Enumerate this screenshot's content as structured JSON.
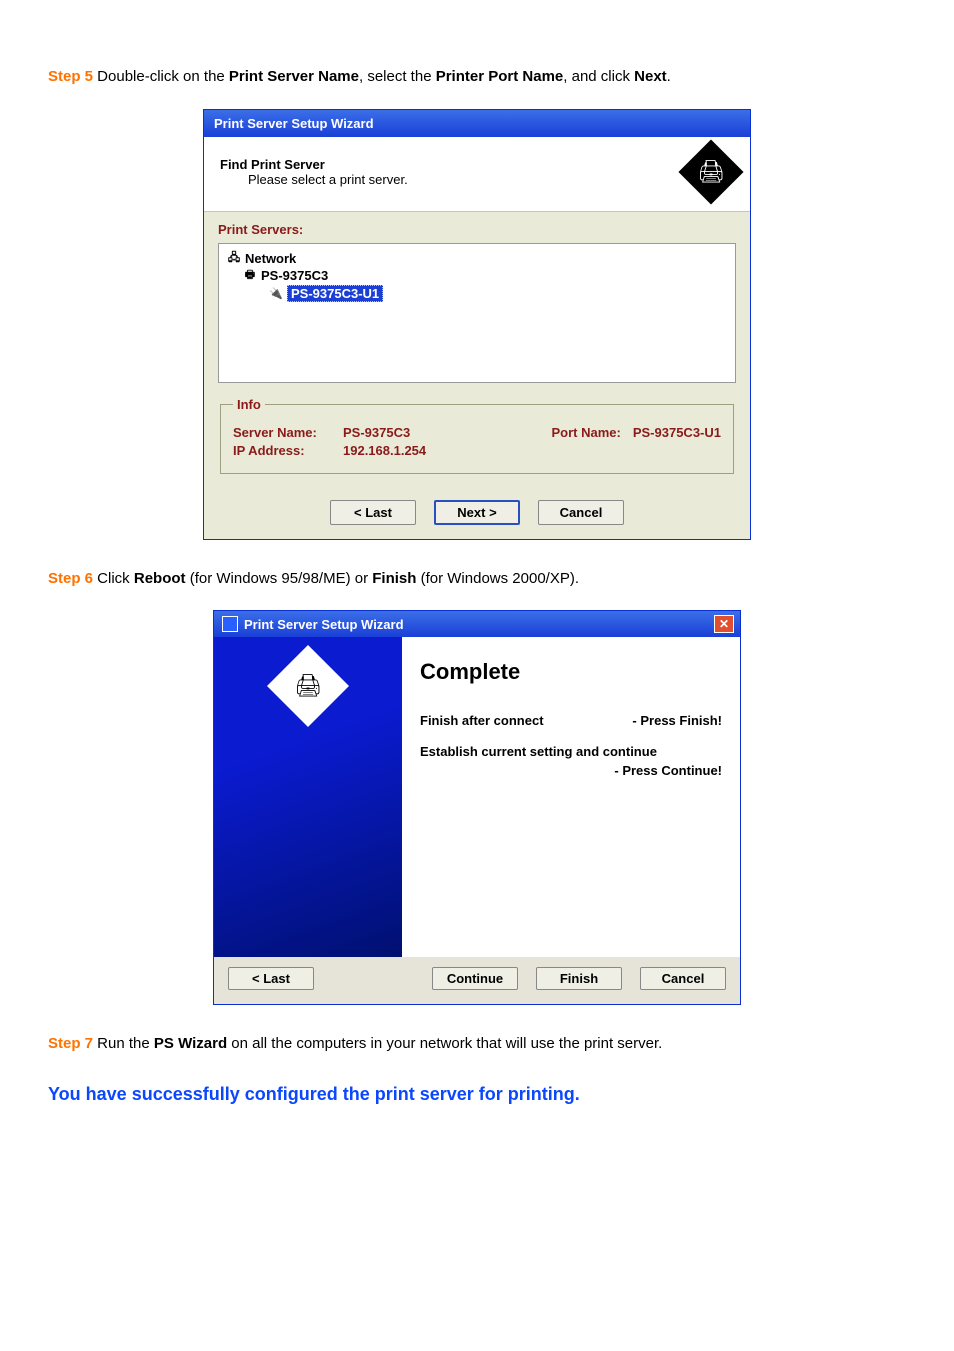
{
  "step5": {
    "label": "Step 5",
    "text_a": " Double-click on the ",
    "bold1": "Print Server Name",
    "text_b": ", select the ",
    "bold2": "Printer Port Name",
    "text_c": ", and click ",
    "bold3": "Next",
    "text_d": "."
  },
  "wizard1": {
    "title": "Print Server Setup Wizard",
    "header_line1": "Find Print Server",
    "header_line2": "Please select a print server.",
    "ps_label": "Print Servers:",
    "tree": {
      "root": "Network",
      "server": "PS-9375C3",
      "port": "PS-9375C3-U1"
    },
    "info": {
      "legend": "Info",
      "server_name_k": "Server Name:",
      "server_name_v": "PS-9375C3",
      "port_name_k": "Port Name:",
      "port_name_v": "PS-9375C3-U1",
      "ip_k": "IP Address:",
      "ip_v": "192.168.1.254"
    },
    "buttons": {
      "last": "< Last",
      "next": "Next >",
      "cancel": "Cancel"
    }
  },
  "step6": {
    "label": "Step 6",
    "text_a": " Click ",
    "bold1": "Reboot",
    "text_b": " (for Windows 95/98/ME) or ",
    "bold2": "Finish",
    "text_c": " (for Windows 2000/XP)."
  },
  "wizard2": {
    "title": "Print Server Setup Wizard",
    "complete": "Complete",
    "line1_l": "Finish after connect",
    "line1_r": "- Press Finish!",
    "line2": "Establish current setting and continue",
    "line2_r": "- Press Continue!",
    "buttons": {
      "last": "< Last",
      "continue": "Continue",
      "finish": "Finish",
      "cancel": "Cancel"
    }
  },
  "step7": {
    "label": "Step 7",
    "text_a": " Run the ",
    "bold1": "PS Wizard",
    "text_b": " on all the computers in your network that will use the print server."
  },
  "success": "You have successfully configured the print server for printing."
}
